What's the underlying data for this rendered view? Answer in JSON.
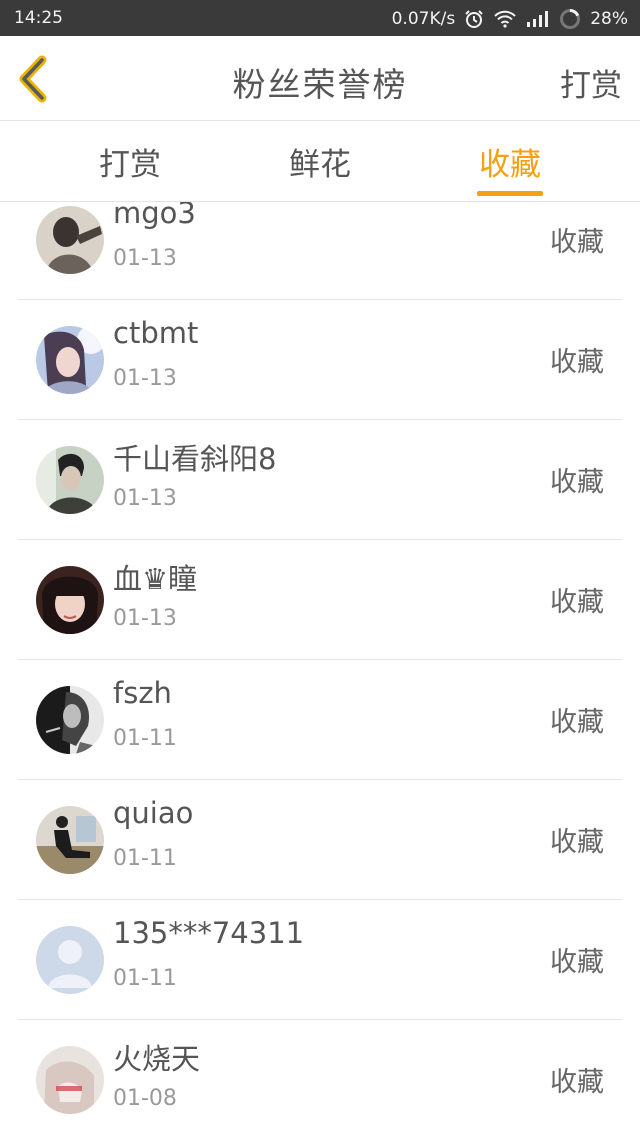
{
  "status_bar": {
    "time": "14:25",
    "network_speed": "0.07K/s",
    "battery": "28%",
    "icons": [
      "alarm-icon",
      "wifi-icon",
      "signal-icon",
      "battery-icon"
    ]
  },
  "header": {
    "back_icon": "chevron-left-icon",
    "title": "粉丝荣誉榜",
    "right_action": "打赏"
  },
  "tabs": [
    {
      "label": "打赏",
      "active": false
    },
    {
      "label": "鲜花",
      "active": false
    },
    {
      "label": "收藏",
      "active": true
    }
  ],
  "accent_color": "#f5a014",
  "list": [
    {
      "name": "mgo3",
      "date": "01-13",
      "action": "收藏"
    },
    {
      "name": "ctbmt",
      "date": "01-13",
      "action": "收藏"
    },
    {
      "name": "千山看斜阳8",
      "date": "01-13",
      "action": "收藏"
    },
    {
      "name": "血♛瞳",
      "date": "01-13",
      "action": "收藏"
    },
    {
      "name": "fszh",
      "date": "01-11",
      "action": "收藏"
    },
    {
      "name": "quiao",
      "date": "01-11",
      "action": "收藏"
    },
    {
      "name": "135***74311",
      "date": "01-11",
      "action": "收藏"
    },
    {
      "name": "火烧天",
      "date": "01-08",
      "action": "收藏"
    }
  ]
}
